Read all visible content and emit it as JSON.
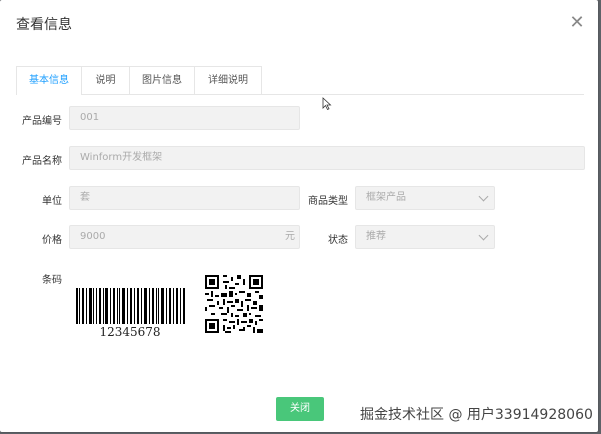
{
  "dialog": {
    "title": "查看信息",
    "close_icon": "close-icon"
  },
  "tabs": [
    {
      "label": "基本信息",
      "active": true
    },
    {
      "label": "说明",
      "active": false
    },
    {
      "label": "图片信息",
      "active": false
    },
    {
      "label": "详细说明",
      "active": false
    }
  ],
  "form": {
    "product_code": {
      "label": "产品编号",
      "value": "001"
    },
    "product_name": {
      "label": "产品名称",
      "value": "Winform开发框架"
    },
    "unit": {
      "label": "单位",
      "value": "套"
    },
    "product_type": {
      "label": "商品类型",
      "value": "框架产品"
    },
    "price": {
      "label": "价格",
      "value": "9000",
      "suffix": "元"
    },
    "status": {
      "label": "状态",
      "value": "推荐"
    },
    "barcode": {
      "label": "条码",
      "barcode_text": "12345678"
    }
  },
  "footer": {
    "close_button": "关闭",
    "button_color": "#49c77a"
  },
  "watermark": "掘金技术社区 @ 用户33914928060",
  "accent_color": "#1e9fff"
}
